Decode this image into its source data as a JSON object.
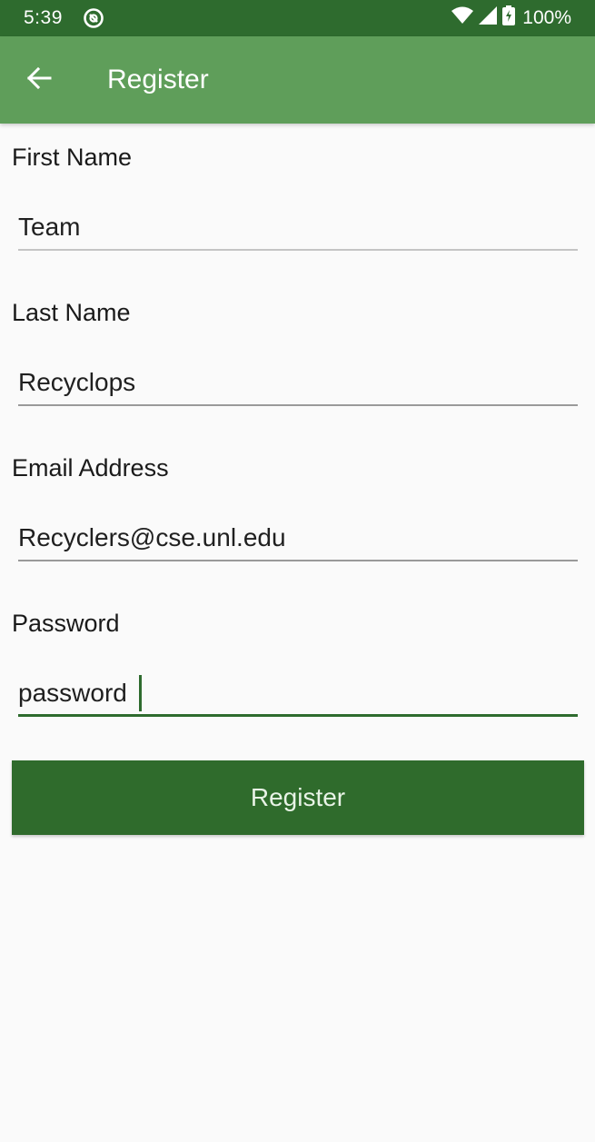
{
  "status_bar": {
    "time": "5:39",
    "battery": "100%",
    "icons": [
      "app-notification-icon",
      "wifi-icon",
      "signal-icon",
      "battery-charging-icon"
    ]
  },
  "app_bar": {
    "title": "Register",
    "back_icon": "arrow-back-icon"
  },
  "form": {
    "first_name": {
      "label": "First Name",
      "value": "Team"
    },
    "last_name": {
      "label": "Last Name",
      "value": "Recyclops"
    },
    "email": {
      "label": "Email Address",
      "value": "Recyclers@cse.unl.edu"
    },
    "password": {
      "label": "Password",
      "value": "password"
    },
    "submit_label": "Register"
  },
  "colors": {
    "status_bar": "#2e6b2e",
    "app_bar": "#5f9e5a",
    "button": "#2f6b2c",
    "background": "#fafafa"
  }
}
